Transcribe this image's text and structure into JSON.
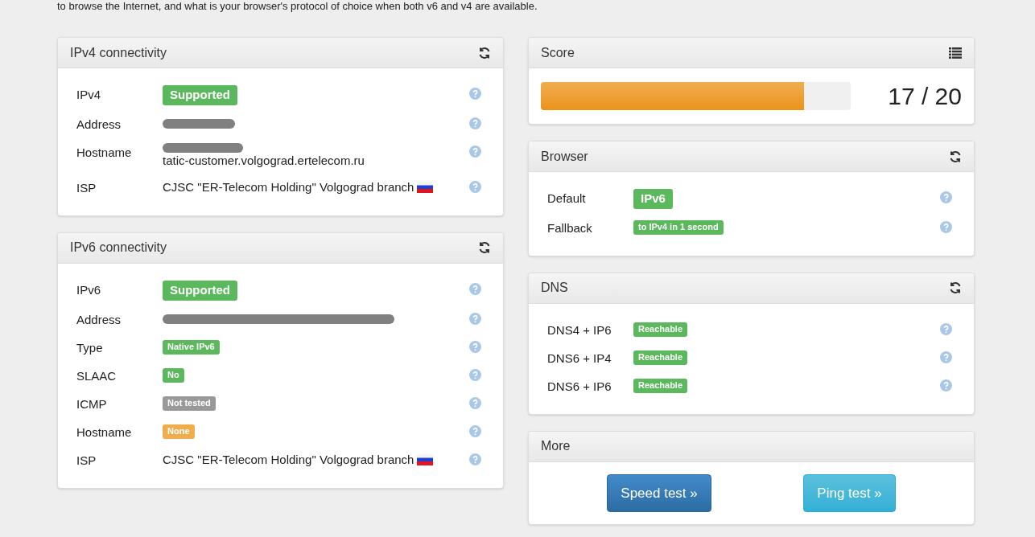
{
  "intro": "to browse the Internet, and what is your browser's protocol of choice when both v6 and v4 are available.",
  "left_panels": [
    {
      "title": "IPv4 connectivity",
      "rows": [
        {
          "label": "IPv4",
          "kind": "badge",
          "badge": {
            "text": "Supported",
            "color": "#5cb85c",
            "kind": "large"
          }
        },
        {
          "label": "Address",
          "kind": "redacted"
        },
        {
          "label": "Hostname",
          "kind": "partial",
          "text": "tatic-customer.volgograd.ertelecom.ru"
        },
        {
          "label": "ISP",
          "kind": "isp",
          "text": "CJSC \"ER-Telecom Holding\" Volgograd branch"
        }
      ]
    },
    {
      "title": "IPv6 connectivity",
      "rows": [
        {
          "label": "IPv6",
          "kind": "badge",
          "badge": {
            "text": "Supported",
            "color": "#5cb85c",
            "kind": "large"
          }
        },
        {
          "label": "Address",
          "kind": "obscured"
        },
        {
          "label": "Type",
          "kind": "badge",
          "badge": {
            "text": "Native IPv6",
            "color": "#5cb85c",
            "kind": "small"
          }
        },
        {
          "label": "SLAAC",
          "kind": "badge",
          "badge": {
            "text": "No",
            "color": "#5cb85c",
            "kind": "small"
          }
        },
        {
          "label": "ICMP",
          "kind": "badge",
          "badge": {
            "text": "Not tested",
            "color": "#999999",
            "kind": "small"
          }
        },
        {
          "label": "Hostname",
          "kind": "badge",
          "badge": {
            "text": "None",
            "color": "#f0ad4e",
            "kind": "small"
          }
        },
        {
          "label": "ISP",
          "kind": "isp",
          "text": "CJSC \"ER-Telecom Holding\" Volgograd branch"
        }
      ]
    }
  ],
  "score": {
    "title": "Score",
    "level": 0.85,
    "reading": "17 / 20"
  },
  "right_panels": [
    {
      "title": "Browser",
      "rows": [
        {
          "label": "Default",
          "kind": "badge",
          "badge": {
            "text": "IPv6",
            "color": "#5cb85c",
            "kind": "large"
          }
        },
        {
          "label": "Fallback",
          "kind": "badge",
          "badge": {
            "text": "to IPv4 in 1 second",
            "color": "#5cb85c",
            "kind": "small"
          }
        }
      ]
    },
    {
      "title": "DNS",
      "rows": [
        {
          "label": "DNS4 + IP6",
          "kind": "badge",
          "badge": {
            "text": "Reachable",
            "color": "#5cb85c",
            "kind": "small"
          }
        },
        {
          "label": "DNS6 + IP4",
          "kind": "badge",
          "badge": {
            "text": "Reachable",
            "color": "#5cb85c",
            "kind": "small"
          }
        },
        {
          "label": "DNS6 + IP6",
          "kind": "badge",
          "badge": {
            "text": "Reachable",
            "color": "#5cb85c",
            "kind": "small"
          }
        }
      ]
    }
  ],
  "more": {
    "title": "More",
    "buttons": [
      {
        "text": "Speed test »",
        "kind": "primary"
      },
      {
        "text": "Ping test »",
        "kind": "info"
      }
    ]
  }
}
